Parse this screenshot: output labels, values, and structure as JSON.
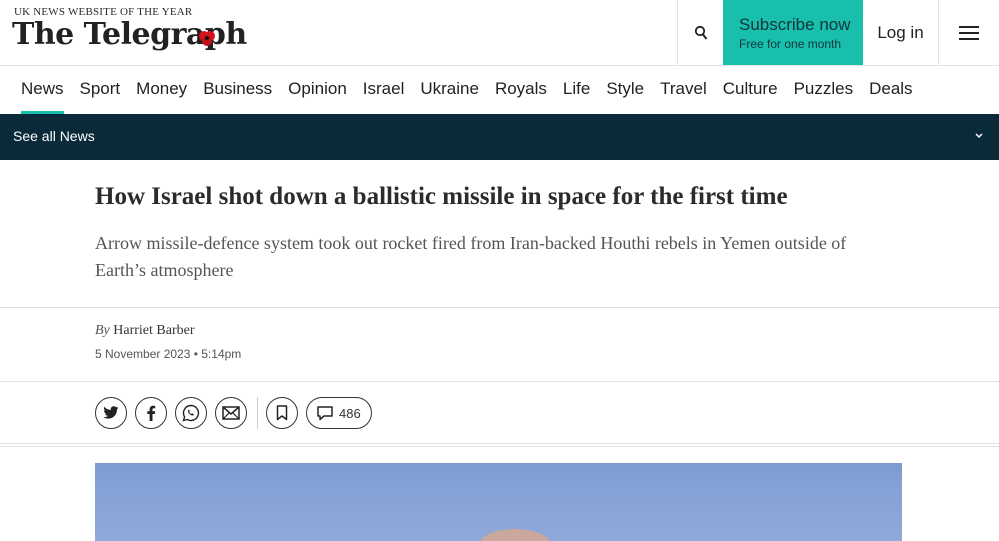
{
  "header": {
    "tagline": "UK NEWS WEBSITE OF THE YEAR",
    "logo": "The Telegraph",
    "subscribe_label": "Subscribe now",
    "subscribe_sub": "Free for one month",
    "login_label": "Log in"
  },
  "nav": {
    "items": [
      "News",
      "Sport",
      "Money",
      "Business",
      "Opinion",
      "Israel",
      "Ukraine",
      "Royals",
      "Life",
      "Style",
      "Travel",
      "Culture",
      "Puzzles",
      "Deals"
    ],
    "active": "News",
    "subnav_label": "See all News"
  },
  "article": {
    "headline": "How Israel shot down a ballistic missile in space for the first time",
    "standfirst": "Arrow missile-defence system took out rocket fired from Iran-backed Houthi rebels in Yemen outside of Earth’s atmosphere",
    "by": "By",
    "author": "Harriet Barber",
    "date": "5 November 2023 • 5:14pm",
    "comment_count": "486"
  },
  "colors": {
    "accent": "#18bfad",
    "subnav_bg": "#0a2a3a"
  }
}
